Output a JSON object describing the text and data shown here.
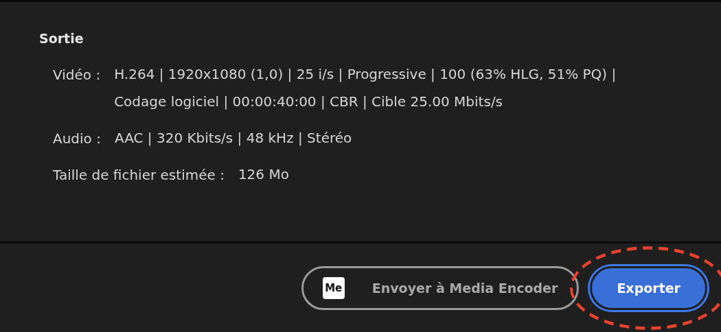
{
  "section": {
    "title": "Sortie",
    "rows": [
      {
        "label": "Vidéo :",
        "lines": [
          "H.264 | 1920x1080 (1,0) | 25 i/s | Progressive | 100 (63% HLG, 51% PQ) |",
          "Codage logiciel | 00:00:40:00  | CBR | Cible 25.00  Mbits/s"
        ]
      },
      {
        "label": "Audio :",
        "lines": [
          "AAC | 320  Kbits/s | 48  kHz | Stéréo"
        ]
      },
      {
        "label": "Taille de fichier estimée :",
        "lines": [
          "126 Mo"
        ]
      }
    ]
  },
  "buttons": [
    {
      "label": "Envoyer à Media Encoder",
      "logo": "Me",
      "kind": "secondary",
      "highlighted": false
    },
    {
      "label": "Exporter",
      "kind": "primary",
      "highlighted": true
    }
  ]
}
